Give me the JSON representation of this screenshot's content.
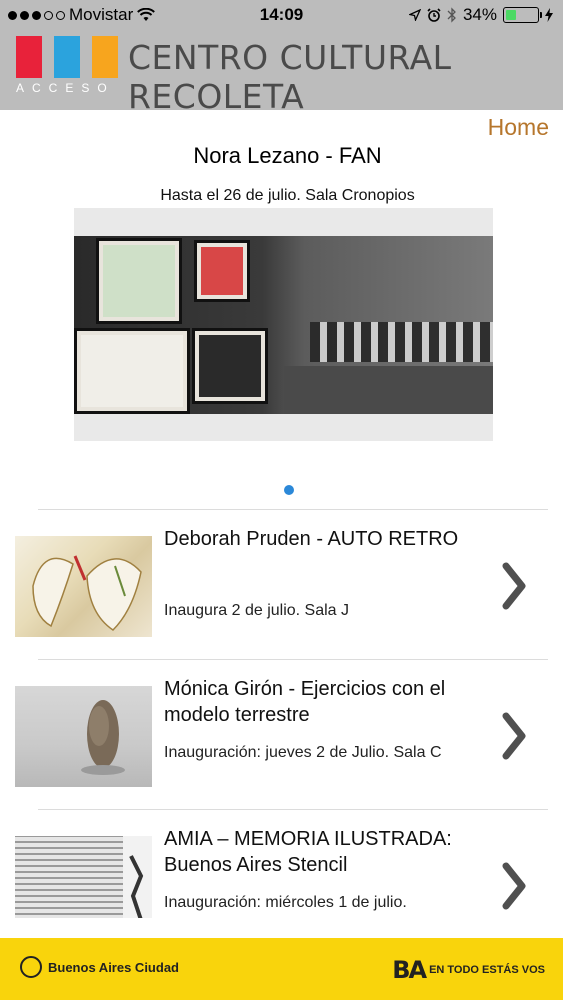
{
  "status_bar": {
    "carrier": "Movistar",
    "time": "14:09",
    "battery_percent": "34%",
    "battery_level": 0.34,
    "icons": [
      "signal-dots-icon",
      "wifi-icon",
      "location-arrow-icon",
      "alarm-icon",
      "bluetooth-icon",
      "battery-icon",
      "charging-bolt-icon"
    ]
  },
  "header": {
    "brand": "CENTRO CULTURAL RECOLETA",
    "logo_subtitle": "ACCESO",
    "logo_colors": [
      "#e8223a",
      "#2ba3dd",
      "#f7a51e"
    ]
  },
  "home_link": "Home",
  "featured": {
    "title": "Nora Lezano - FAN",
    "subtitle": "Hasta el 26 de julio. Sala Cronopios",
    "pager_index": 0,
    "pager_color": "#2b88d8"
  },
  "items": [
    {
      "title": "Deborah Pruden - AUTO RETRO",
      "subtitle": "Inaugura 2 de julio. Sala J"
    },
    {
      "title": "Mónica Girón - Ejercicios con el modelo terrestre",
      "subtitle": "Inauguración: jueves 2 de Julio. Sala C"
    },
    {
      "title": "AMIA – MEMORIA ILUSTRADA: Buenos Aires Stencil",
      "subtitle": "Inauguración: miércoles 1 de julio."
    }
  ],
  "footer": {
    "left_label": "Buenos Aires Ciudad",
    "right_logo": "BA",
    "right_label": "EN TODO ESTÁS VOS",
    "background": "#f9d40c"
  },
  "colors": {
    "home_link": "#b6762c",
    "chevron": "#505050",
    "header_bg": "#bcbcbc"
  }
}
